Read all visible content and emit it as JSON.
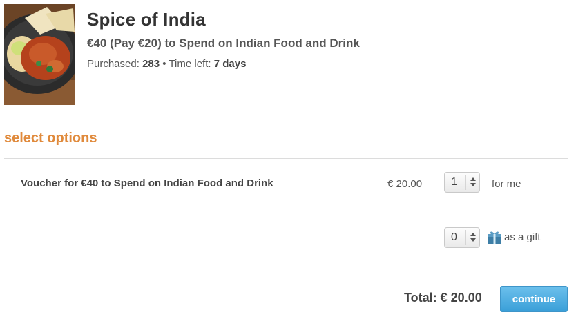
{
  "deal": {
    "image_alt": "Indian curry dish with poppadoms",
    "title": "Spice of India",
    "subtitle": "€40 (Pay €20) to Spend on Indian Food and Drink",
    "purchased_label": "Purchased:",
    "purchased_count": "283",
    "separator": "•",
    "time_left_label": "Time left:",
    "time_left_value": "7 days"
  },
  "options": {
    "heading": "select options",
    "item": {
      "name": "Voucher for €40 to Spend on Indian Food and Drink",
      "price": "€ 20.00",
      "for_me": {
        "quantity": "1",
        "label": "for me"
      },
      "gift": {
        "quantity": "0",
        "label": "as a gift",
        "icon": "gift-icon"
      }
    }
  },
  "footer": {
    "total": "Total: € 20.00",
    "continue_label": "continue"
  },
  "colors": {
    "accent_orange": "#e08a3c",
    "button_blue": "#3a9fd8",
    "gift_blue": "#3d7ea6"
  }
}
